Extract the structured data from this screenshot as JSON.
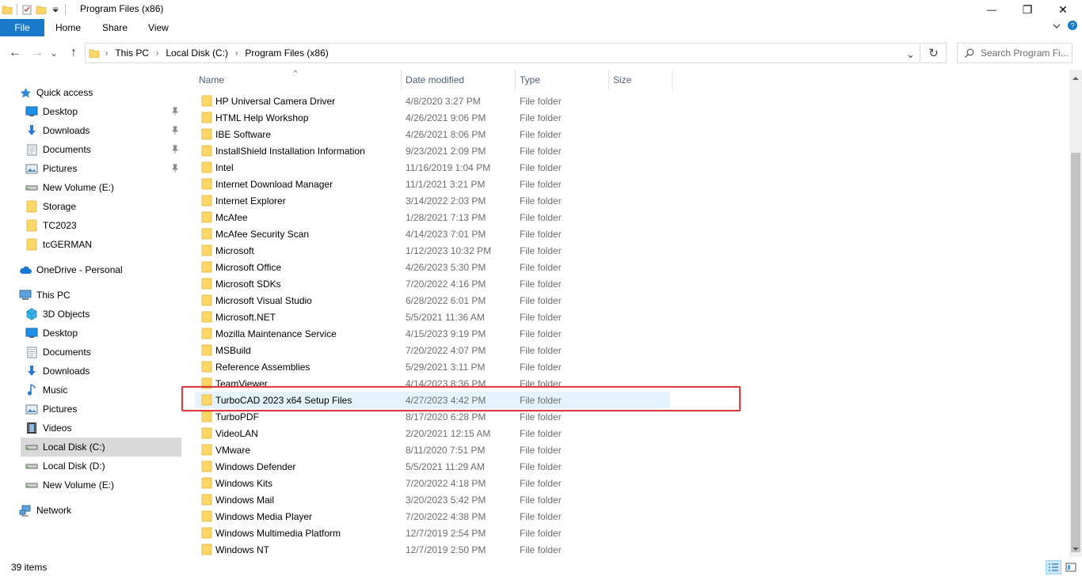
{
  "window": {
    "title": "Program Files (x86)",
    "controls": {
      "minimize": "—",
      "restore": "❐",
      "close": "✕"
    }
  },
  "ribbon": {
    "tabs": [
      "File",
      "Home",
      "Share",
      "View"
    ],
    "expand_icon": "chevron-down-icon",
    "help_icon": "help-icon",
    "help_glyph": "?"
  },
  "navigation": {
    "back_glyph": "←",
    "forward_glyph": "→",
    "recent_glyph": "⌄",
    "up_glyph": "↑"
  },
  "address": {
    "breadcrumbs": [
      "This PC",
      "Local Disk (C:)",
      "Program Files (x86)"
    ],
    "separator": "›",
    "dropdown_glyph": "⌄",
    "refresh_glyph": "↻"
  },
  "search": {
    "placeholder": "Search Program Fi..."
  },
  "nav_pane": {
    "quick_access": {
      "label": "Quick access",
      "items": [
        {
          "label": "Desktop",
          "icon": "desktop-icon",
          "pinned": true
        },
        {
          "label": "Downloads",
          "icon": "download-icon",
          "pinned": true
        },
        {
          "label": "Documents",
          "icon": "document-icon",
          "pinned": true
        },
        {
          "label": "Pictures",
          "icon": "pictures-icon",
          "pinned": true
        },
        {
          "label": "New Volume (E:)",
          "icon": "drive-icon",
          "pinned": false
        },
        {
          "label": "Storage",
          "icon": "folder-icon",
          "pinned": false
        },
        {
          "label": "TC2023",
          "icon": "folder-icon",
          "pinned": false
        },
        {
          "label": "tcGERMAN",
          "icon": "folder-icon",
          "pinned": false
        }
      ]
    },
    "onedrive": {
      "label": "OneDrive - Personal"
    },
    "this_pc": {
      "label": "This PC",
      "items": [
        {
          "label": "3D Objects",
          "icon": "3d-objects-icon"
        },
        {
          "label": "Desktop",
          "icon": "desktop-icon"
        },
        {
          "label": "Documents",
          "icon": "document-icon"
        },
        {
          "label": "Downloads",
          "icon": "download-icon"
        },
        {
          "label": "Music",
          "icon": "music-icon"
        },
        {
          "label": "Pictures",
          "icon": "pictures-icon"
        },
        {
          "label": "Videos",
          "icon": "video-icon"
        },
        {
          "label": "Local Disk (C:)",
          "icon": "drive-icon",
          "selected": true
        },
        {
          "label": "Local Disk (D:)",
          "icon": "drive-icon"
        },
        {
          "label": "New Volume (E:)",
          "icon": "drive-icon"
        }
      ]
    },
    "network": {
      "label": "Network"
    }
  },
  "file_list": {
    "columns": [
      "Name",
      "Date modified",
      "Type",
      "Size"
    ],
    "sort_glyph": "^",
    "rows": [
      {
        "name": "HP Universal Camera Driver",
        "date": "4/8/2020 3:27 PM",
        "type": "File folder"
      },
      {
        "name": "HTML Help Workshop",
        "date": "4/26/2021 9:06 PM",
        "type": "File folder"
      },
      {
        "name": "IBE Software",
        "date": "4/26/2021 8:06 PM",
        "type": "File folder"
      },
      {
        "name": "InstallShield Installation Information",
        "date": "9/23/2021 2:09 PM",
        "type": "File folder"
      },
      {
        "name": "Intel",
        "date": "11/16/2019 1:04 PM",
        "type": "File folder"
      },
      {
        "name": "Internet Download Manager",
        "date": "11/1/2021 3:21 PM",
        "type": "File folder"
      },
      {
        "name": "Internet Explorer",
        "date": "3/14/2022 2:03 PM",
        "type": "File folder"
      },
      {
        "name": "McAfee",
        "date": "1/28/2021 7:13 PM",
        "type": "File folder"
      },
      {
        "name": "McAfee Security Scan",
        "date": "4/14/2023 7:01 PM",
        "type": "File folder"
      },
      {
        "name": "Microsoft",
        "date": "1/12/2023 10:32 PM",
        "type": "File folder"
      },
      {
        "name": "Microsoft Office",
        "date": "4/26/2023 5:30 PM",
        "type": "File folder"
      },
      {
        "name": "Microsoft SDKs",
        "date": "7/20/2022 4:16 PM",
        "type": "File folder"
      },
      {
        "name": "Microsoft Visual Studio",
        "date": "6/28/2022 6:01 PM",
        "type": "File folder"
      },
      {
        "name": "Microsoft.NET",
        "date": "5/5/2021 11:36 AM",
        "type": "File folder"
      },
      {
        "name": "Mozilla Maintenance Service",
        "date": "4/15/2023 9:19 PM",
        "type": "File folder"
      },
      {
        "name": "MSBuild",
        "date": "7/20/2022 4:07 PM",
        "type": "File folder"
      },
      {
        "name": "Reference Assemblies",
        "date": "5/29/2021 3:11 PM",
        "type": "File folder"
      },
      {
        "name": "TeamViewer",
        "date": "4/14/2023 8:36 PM",
        "type": "File folder"
      },
      {
        "name": "TurboCAD 2023 x64 Setup Files",
        "date": "4/27/2023 4:42 PM",
        "type": "File folder",
        "highlighted": true
      },
      {
        "name": "TurboPDF",
        "date": "8/17/2020 6:28 PM",
        "type": "File folder"
      },
      {
        "name": "VideoLAN",
        "date": "2/20/2021 12:15 AM",
        "type": "File folder"
      },
      {
        "name": "VMware",
        "date": "8/11/2020 7:51 PM",
        "type": "File folder"
      },
      {
        "name": "Windows Defender",
        "date": "5/5/2021 11:29 AM",
        "type": "File folder"
      },
      {
        "name": "Windows Kits",
        "date": "7/20/2022 4:18 PM",
        "type": "File folder"
      },
      {
        "name": "Windows Mail",
        "date": "3/20/2023 5:42 PM",
        "type": "File folder"
      },
      {
        "name": "Windows Media Player",
        "date": "7/20/2022 4:38 PM",
        "type": "File folder"
      },
      {
        "name": "Windows Multimedia Platform",
        "date": "12/7/2019 2:54 PM",
        "type": "File folder"
      },
      {
        "name": "Windows NT",
        "date": "12/7/2019 2:50 PM",
        "type": "File folder"
      }
    ]
  },
  "status": {
    "item_count": "39 items"
  },
  "colors": {
    "accent": "#1979ca",
    "highlight_row": "#e5f3ff",
    "annotation_box": "#e0393e",
    "folder": "#ffd766",
    "selected_nav": "#d9d9d9"
  }
}
